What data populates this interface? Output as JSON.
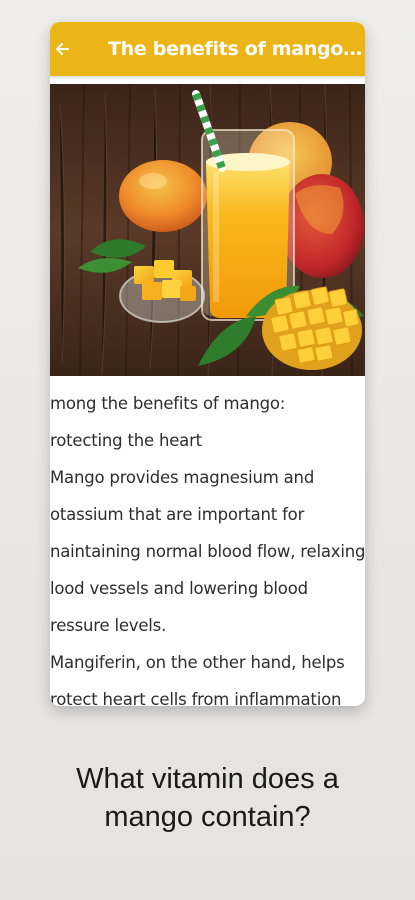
{
  "app_bar": {
    "title": "The benefits of mango f…",
    "back_icon": "arrow-left-icon",
    "color": "#ecb517"
  },
  "hero_image": {
    "description_icon": "mango-juice-image"
  },
  "article": {
    "lines": [
      "mong the benefits of mango:",
      "rotecting the heart",
      "Mango provides magnesium and",
      "otassium that are important for",
      "naintaining normal blood flow, relaxing",
      "lood vessels and lowering blood",
      "ressure levels.",
      "Mangiferin, on the other hand, helps",
      "rotect heart cells from inflammation"
    ]
  },
  "caption": {
    "line1": "What vitamin does a",
    "line2": "mango contain?"
  }
}
